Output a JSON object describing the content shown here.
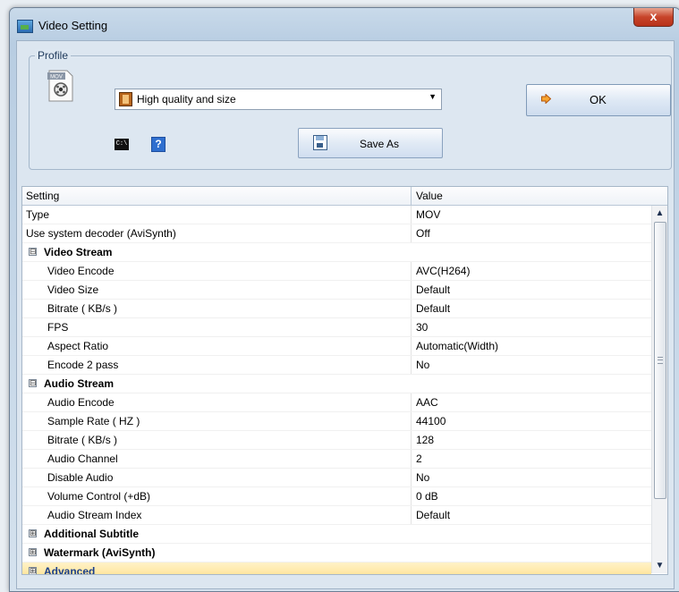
{
  "window": {
    "title": "Video Setting",
    "close_label": "x"
  },
  "profile": {
    "group_label": "Profile",
    "selected_profile": "High quality and size",
    "ok_label": "OK",
    "save_as_label": "Save As",
    "movie_icon_text": "MOV",
    "cmd_icon_text": "C:\\",
    "help_icon_text": "?"
  },
  "grid": {
    "columns": [
      "Setting",
      "Value"
    ],
    "rows": [
      {
        "type": "item",
        "name": "Type",
        "value": "MOV"
      },
      {
        "type": "item",
        "name": "Use system decoder (AviSynth)",
        "value": "Off"
      },
      {
        "type": "category",
        "name": "Video Stream",
        "expanded": true,
        "expander": "⊟"
      },
      {
        "type": "child",
        "name": "Video Encode",
        "value": "AVC(H264)"
      },
      {
        "type": "child",
        "name": "Video Size",
        "value": "Default"
      },
      {
        "type": "child",
        "name": "Bitrate ( KB/s )",
        "value": "Default"
      },
      {
        "type": "child",
        "name": "FPS",
        "value": "30"
      },
      {
        "type": "child",
        "name": "Aspect Ratio",
        "value": "Automatic(Width)"
      },
      {
        "type": "child",
        "name": "Encode 2 pass",
        "value": "No"
      },
      {
        "type": "category",
        "name": "Audio Stream",
        "expanded": true,
        "expander": "⊟"
      },
      {
        "type": "child",
        "name": "Audio Encode",
        "value": "AAC"
      },
      {
        "type": "child",
        "name": "Sample Rate ( HZ )",
        "value": "44100"
      },
      {
        "type": "child",
        "name": "Bitrate ( KB/s )",
        "value": "128"
      },
      {
        "type": "child",
        "name": "Audio Channel",
        "value": "2"
      },
      {
        "type": "child",
        "name": "Disable Audio",
        "value": "No"
      },
      {
        "type": "child",
        "name": "Volume Control (+dB)",
        "value": "0 dB"
      },
      {
        "type": "child",
        "name": "Audio Stream Index",
        "value": "Default"
      },
      {
        "type": "category",
        "name": "Additional Subtitle",
        "expanded": false,
        "expander": "⊞"
      },
      {
        "type": "category",
        "name": "Watermark (AviSynth)",
        "expanded": false,
        "expander": "⊞"
      },
      {
        "type": "category",
        "name": "Advanced",
        "expanded": false,
        "expander": "⊞",
        "selected": true
      }
    ]
  },
  "colors": {
    "selection": "#ffdf8a",
    "window_chrome": "#b8cde2"
  }
}
